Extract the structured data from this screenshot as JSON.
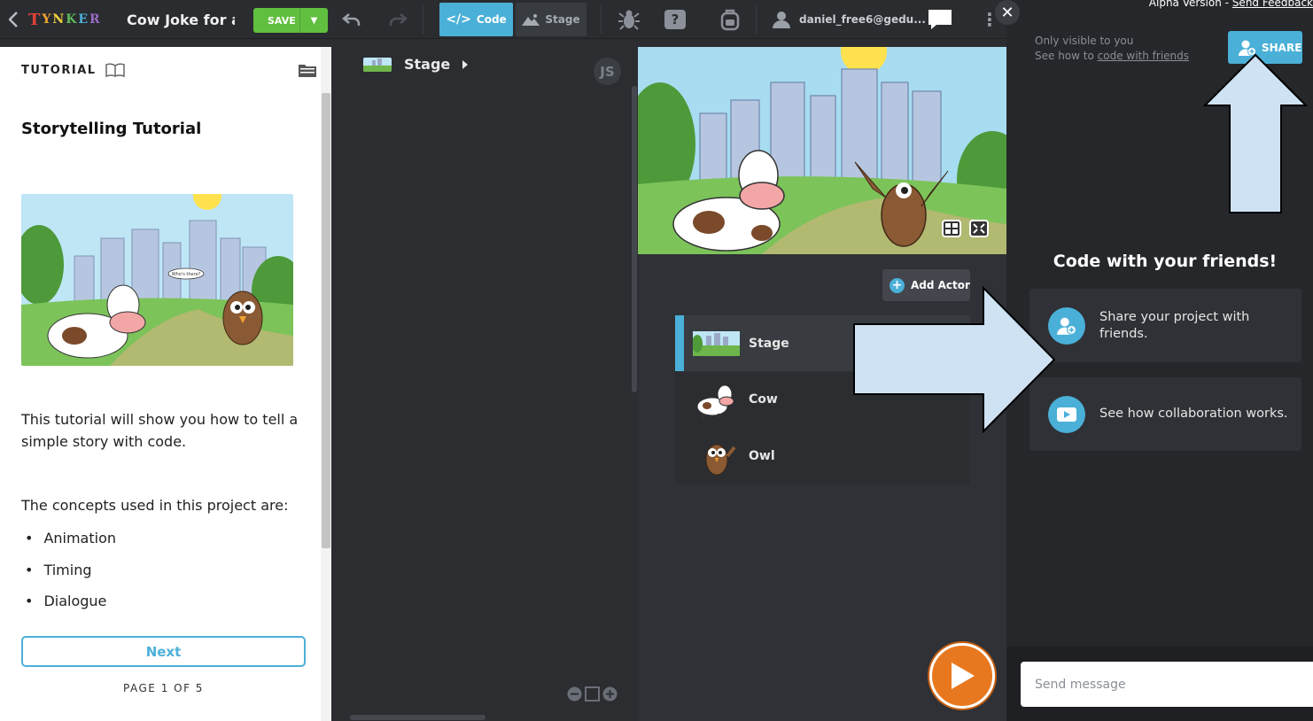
{
  "topbar": {
    "logo_letters": [
      "T",
      "Y",
      "N",
      "K",
      "E",
      "R"
    ],
    "logo_colors": [
      "#e0403a",
      "#f3a431",
      "#f2d03b",
      "#5db95a",
      "#4bb0d8",
      "#9a6bc7"
    ],
    "project_title": "Cow Joke for ass",
    "save_label": "SAVE",
    "code_tab": "Code",
    "code_tab_icon": "</>",
    "stage_tab": "Stage",
    "user_email": "daniel_free6@gedu..."
  },
  "tutorial": {
    "header": "TUTORIAL",
    "title": "Storytelling Tutorial",
    "image_speech": "Who's there?",
    "description": "This tutorial will show you how to tell a simple story with code.",
    "concepts_intro": "The concepts used in this project are:",
    "concepts": [
      "Animation",
      "Timing",
      "Dialogue"
    ],
    "next_label": "Next",
    "page_indicator": "PAGE 1 OF 5"
  },
  "code": {
    "breadcrumb": "Stage",
    "js_badge": "JS"
  },
  "actors": {
    "add_label": "Add Actor",
    "list": [
      {
        "name": "Stage",
        "selected": true
      },
      {
        "name": "Cow",
        "selected": false
      },
      {
        "name": "Owl",
        "selected": false
      }
    ]
  },
  "right": {
    "alpha_prefix": "Alpha Version - ",
    "alpha_link": "Send Feedback",
    "visible_note": "Only visible to you",
    "see_how_prefix": "See how to ",
    "see_how_link": "code with friends",
    "share_label": "SHARE",
    "friends_title": "Code with your friends!",
    "card_share": "Share your project with friends.",
    "card_collab": "See how collaboration works.",
    "message_placeholder": "Send message"
  },
  "colors": {
    "accent": "#4bb0d8",
    "save_green": "#61bf3f",
    "play_orange": "#e8781f",
    "arrow_fill": "#cfe2f3"
  }
}
